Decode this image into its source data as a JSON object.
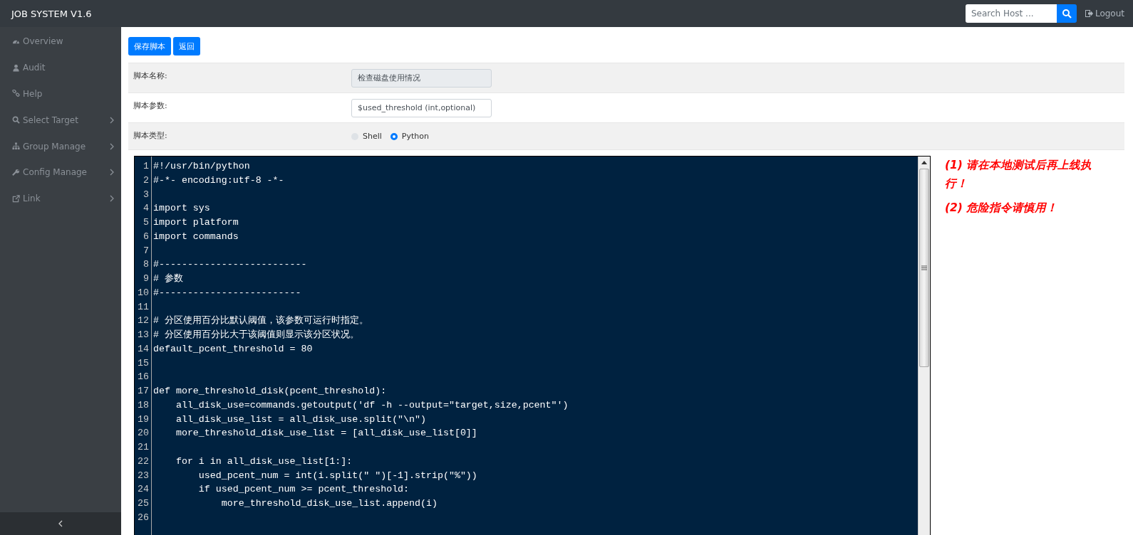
{
  "topbar": {
    "brand": "JOB SYSTEM V1.6",
    "search": {
      "placeholder": "Search Host ..."
    },
    "logout": "Logout"
  },
  "sidebar": {
    "items": [
      {
        "label": "Overview",
        "expandable": false
      },
      {
        "label": "Audit",
        "expandable": false
      },
      {
        "label": "Help",
        "expandable": false
      },
      {
        "label": "Select Target",
        "expandable": true
      },
      {
        "label": "Group Manage",
        "expandable": true
      },
      {
        "label": "Config Manage",
        "expandable": true
      },
      {
        "label": "Link",
        "expandable": true
      }
    ]
  },
  "actions": [
    "保存脚本",
    "返回"
  ],
  "form": [
    {
      "label": "脚本名称:",
      "kind": "readonly",
      "value": "检查磁盘使用情况"
    },
    {
      "label": "脚本参数:",
      "kind": "input",
      "value": "$used_threshold (int,optional)"
    },
    {
      "label": "脚本类型:",
      "kind": "radio",
      "options": [
        {
          "label": "Shell",
          "selected": false
        },
        {
          "label": "Python",
          "selected": true
        }
      ]
    }
  ],
  "editor": {
    "lines": [
      {
        "number": "1",
        "text": "#!/usr/bin/python"
      },
      {
        "number": "2",
        "text": "#-*- encoding:utf-8 -*-"
      },
      {
        "number": "3"
      },
      {
        "number": "4",
        "text": "import sys"
      },
      {
        "number": "5",
        "text": "import platform"
      },
      {
        "number": "6",
        "text": "import commands"
      },
      {
        "number": "7"
      },
      {
        "number": "8",
        "text": "#--------------------------"
      },
      {
        "number": "9",
        "text": "# 参数"
      },
      {
        "number": "10",
        "text": "#-------------------------"
      },
      {
        "number": "11"
      },
      {
        "number": "12",
        "text": "# 分区使用百分比默认阈值，该参数可运行时指定。"
      },
      {
        "number": "13",
        "text": "# 分区使用百分比大于该阈值则显示该分区状况。"
      },
      {
        "number": "14",
        "text": "default_pcent_threshold = 80"
      },
      {
        "number": "15"
      },
      {
        "number": "16"
      },
      {
        "number": "17",
        "text": "def more_threshold_disk(pcent_threshold):"
      },
      {
        "number": "18",
        "text": "    all_disk_use=commands.getoutput('df -h --output=\"target,size,pcent\"')"
      },
      {
        "number": "19",
        "text": "    all_disk_use_list = all_disk_use.split(\"\\n\")"
      },
      {
        "number": "20",
        "text": "    more_threshold_disk_use_list = [all_disk_use_list[0]]"
      },
      {
        "number": "21"
      },
      {
        "number": "22",
        "text": "    for i in all_disk_use_list[1:]:"
      },
      {
        "number": "23",
        "text": "        used_pcent_num = int(i.split(\" \")[-1].strip(\"%\"))"
      },
      {
        "number": "24",
        "text": "        if used_pcent_num >= pcent_threshold:"
      },
      {
        "number": "25",
        "text": "            more_threshold_disk_use_list.append(i)"
      },
      {
        "number": "26"
      }
    ]
  },
  "notes": [
    "(1) 请在本地测试后再上线执行！",
    "(2) 危险指令请慎用！"
  ]
}
